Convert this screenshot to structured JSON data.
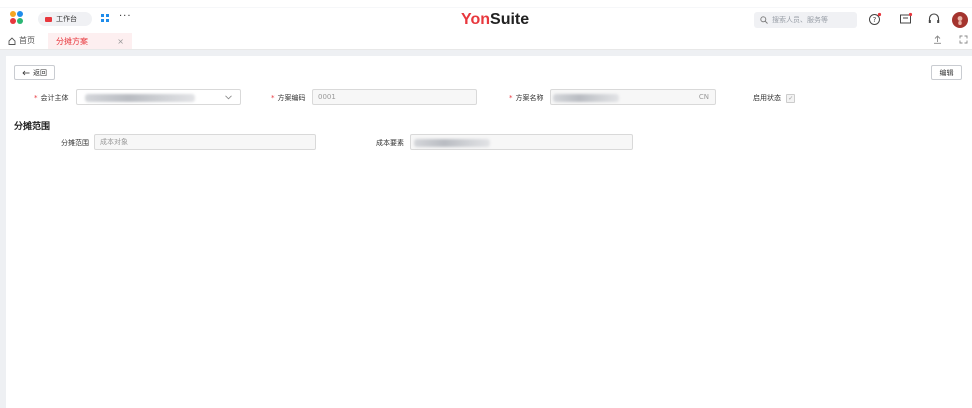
{
  "header": {
    "workspace_label": "工作台",
    "more_label": "···",
    "brand_yon": "Yon",
    "brand_suite": "Suite",
    "search_placeholder": "搜索人员、服务等",
    "brand_color": "#e8373d"
  },
  "tabs": {
    "home_label": "首页",
    "active_label": "分摊方案",
    "close_glyph": "×"
  },
  "toolbar": {
    "back_label": "返回",
    "edit_label": "编辑"
  },
  "form": {
    "accounting_entity_label": "会计主体",
    "scheme_code_label": "方案编码",
    "scheme_code_value": "0001",
    "scheme_name_label": "方案名称",
    "scheme_name_suffix": "CN",
    "enabled_label": "启用状态",
    "required_mark": "*"
  },
  "section": {
    "title": "分摊范围",
    "range_label": "分摊范围",
    "range_placeholder": "成本对象",
    "cost_element_label": "成本要素"
  },
  "icons": [
    "app-logo-icon",
    "workbench-icon",
    "apps-grid-icon",
    "search-icon",
    "help-icon",
    "message-icon",
    "headset-icon",
    "home-icon",
    "upload-icon",
    "fullscreen-icon",
    "back-arrow-icon",
    "chevron-down-icon",
    "check-icon"
  ]
}
